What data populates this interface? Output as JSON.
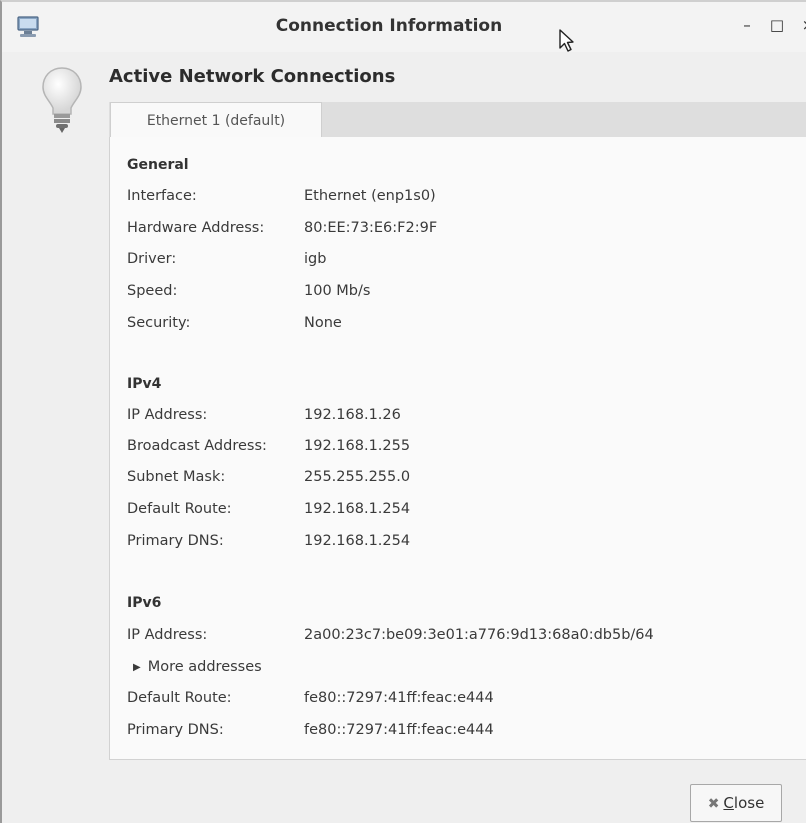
{
  "window": {
    "title": "Connection Information",
    "controls": {
      "minimize": "–",
      "maximize": "□",
      "close": "×"
    }
  },
  "heading": "Active Network Connections",
  "tab": {
    "label": "Ethernet 1 (default)"
  },
  "general": {
    "title": "General",
    "rows": [
      {
        "label": "Interface:",
        "value": "Ethernet (enp1s0)"
      },
      {
        "label": "Hardware Address:",
        "value": "80:EE:73:E6:F2:9F"
      },
      {
        "label": "Driver:",
        "value": "igb"
      },
      {
        "label": "Speed:",
        "value": "100 Mb/s"
      },
      {
        "label": "Security:",
        "value": "None"
      }
    ]
  },
  "ipv4": {
    "title": "IPv4",
    "rows": [
      {
        "label": "IP Address:",
        "value": "192.168.1.26"
      },
      {
        "label": "Broadcast Address:",
        "value": "192.168.1.255"
      },
      {
        "label": "Subnet Mask:",
        "value": "255.255.255.0"
      },
      {
        "label": "Default Route:",
        "value": "192.168.1.254"
      },
      {
        "label": "Primary DNS:",
        "value": "192.168.1.254"
      }
    ]
  },
  "ipv6": {
    "title": "IPv6",
    "ip_label": "IP Address:",
    "ip_value": "2a00:23c7:be09:3e01:a776:9d13:68a0:db5b/64",
    "more_addresses": "More addresses",
    "rows": [
      {
        "label": "Default Route:",
        "value": "fe80::7297:41ff:feac:e444"
      },
      {
        "label": "Primary DNS:",
        "value": "fe80::7297:41ff:feac:e444"
      }
    ]
  },
  "close_button": {
    "label_first": "C",
    "label_rest": "lose",
    "icon": "close-x-icon"
  },
  "icons": {
    "app": "network-computer-icon",
    "bulb": "lightbulb-icon"
  }
}
